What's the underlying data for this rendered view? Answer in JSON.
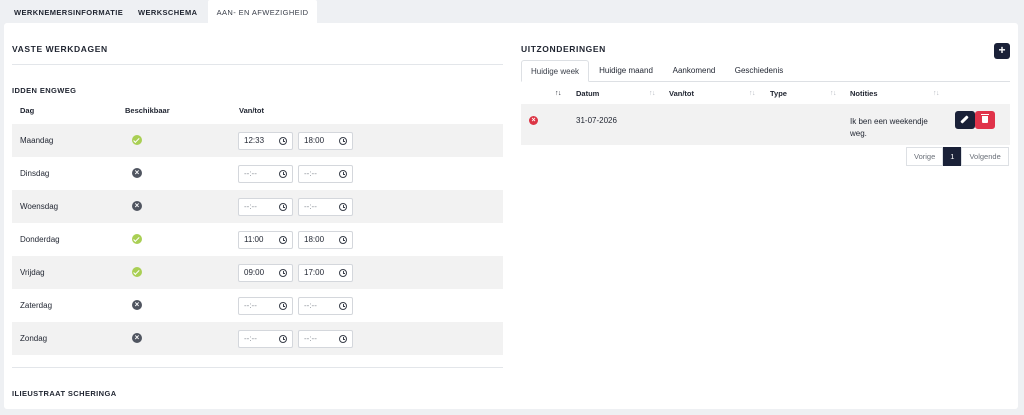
{
  "topnav": {
    "tabs": [
      {
        "label": "WERKNEMERSINFORMATIE"
      },
      {
        "label": "WERKSCHEMA"
      },
      {
        "label": "AAN- EN AFWEZIGHEID"
      }
    ],
    "active_tab": "AAN- EN AFWEZIGHEID"
  },
  "fixed_days": {
    "title": "VASTE WERKDAGEN",
    "employee_1": "IDDEN ENGWEG",
    "employee_2": "ILIEUSTRAAT SCHERINGA",
    "columns": {
      "day": "Dag",
      "available": "Beschikbaar",
      "time": "Van/tot"
    },
    "rows": [
      {
        "day": "Maandag",
        "available": true,
        "from": "12:33",
        "to": "18:00"
      },
      {
        "day": "Dinsdag",
        "available": false,
        "from": "--:--",
        "to": "--:--"
      },
      {
        "day": "Woensdag",
        "available": false,
        "from": "--:--",
        "to": "--:--"
      },
      {
        "day": "Donderdag",
        "available": true,
        "from": "11:00",
        "to": "18:00"
      },
      {
        "day": "Vrijdag",
        "available": true,
        "from": "09:00",
        "to": "17:00"
      },
      {
        "day": "Zaterdag",
        "available": false,
        "from": "--:--",
        "to": "--:--"
      },
      {
        "day": "Zondag",
        "available": false,
        "from": "--:--",
        "to": "--:--"
      }
    ],
    "icons": {
      "available": "check-circle-icon",
      "unavailable": "x-circle-icon",
      "time": "clock-icon"
    },
    "colors": {
      "available": "#a9cf54",
      "unavailable": "#505560"
    }
  },
  "exceptions": {
    "title": "UITZONDERINGEN",
    "add_label": "+",
    "tabs": [
      "Huidige week",
      "Huidige maand",
      "Aankomend",
      "Geschiedenis"
    ],
    "active_tab": "Huidige week",
    "columns": {
      "date": "Datum",
      "time": "Van/tot",
      "type": "Type",
      "notes": "Notities"
    },
    "sort_glyph": "↑↓",
    "rows": [
      {
        "status": "cancelled",
        "status_glyph": "×",
        "date": "31-07-2026",
        "time": "",
        "type": "",
        "notes": "Ik ben een weekendje weg."
      }
    ],
    "pagination": {
      "prev": "Vorige",
      "current": "1",
      "next": "Volgende"
    },
    "colors": {
      "primary": "#1a2138",
      "danger": "#e0334a",
      "cancel": "#dc3545"
    }
  }
}
